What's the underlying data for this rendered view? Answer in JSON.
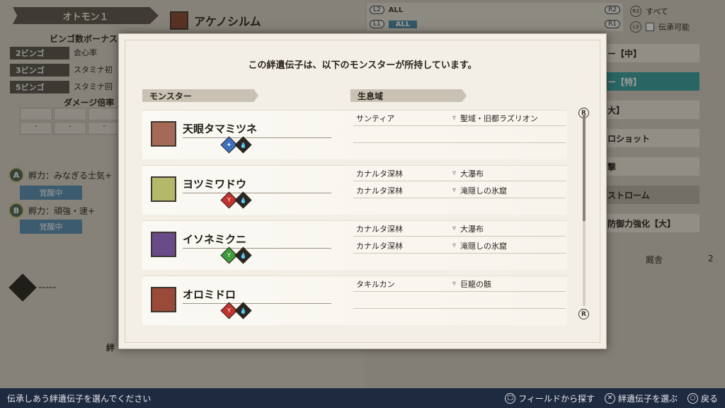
{
  "background": {
    "otomon_tab": "オトモン１",
    "monster_name": "アケノシルム",
    "bingo_title": "ビンゴ数ボーナス",
    "bingo_rows": [
      {
        "tag": "2ビンゴ",
        "effect": "会心率"
      },
      {
        "tag": "3ビンゴ",
        "effect": "スタミナ初"
      },
      {
        "tag": "5ビンゴ",
        "effect": "スタミナ回"
      }
    ],
    "damage_title": "ダメージ倍率",
    "damage_cells": [
      "-",
      "-",
      "-"
    ],
    "skill_a_badge": "A",
    "skill_a": "孵力：みなぎる士気+",
    "skill_b_badge": "B",
    "skill_b": "孵力：頑強・速+",
    "awake_label": "覚醒中",
    "dash_text": "-----",
    "left_bottom_text": "絆",
    "filter_l2": "L2",
    "filter_r2": "R2",
    "filter_l1": "L1",
    "filter_r1": "R1",
    "filter_all_top": "ALL",
    "filter_all_bottom": "ALL",
    "r3_btn": "R3",
    "l3_btn": "L3",
    "filter_right_top": "すべて",
    "filter_right_bottom": "伝承可能",
    "side_items": [
      {
        "label": "ー【中】",
        "style": "normal"
      },
      {
        "label": "ー【特】",
        "style": "special"
      },
      {
        "label": "大】",
        "style": "normal"
      },
      {
        "label": "ロショット",
        "style": "normal"
      },
      {
        "label": "撃",
        "style": "normal"
      },
      {
        "label": "ストローム",
        "style": "dark"
      },
      {
        "label": "防御力強化【大】",
        "style": "normal"
      }
    ],
    "kennel_label": "厩舎",
    "kennel_value": "2"
  },
  "modal": {
    "title": "この絆遺伝子は、以下のモンスターが所持しています。",
    "col_monster": "モンスター",
    "col_habitat": "生息域",
    "scroll_top_btn": "R",
    "scroll_bottom_btn": "R",
    "monsters": [
      {
        "name": "天眼タマミツネ",
        "icon": "tamamitsune-icon",
        "genes": [
          {
            "color": "blue",
            "glyph": "✦"
          },
          {
            "color": "black",
            "glyph": "💧"
          }
        ],
        "habitats": [
          {
            "region": "サンティア",
            "area": "聖域・旧都ラズリオン"
          },
          {
            "region": "",
            "area": ""
          }
        ]
      },
      {
        "name": "ヨツミワドウ",
        "icon": "yotsumiwadou-icon",
        "genes": [
          {
            "color": "red",
            "glyph": "Y"
          },
          {
            "color": "black",
            "glyph": "💧"
          }
        ],
        "habitats": [
          {
            "region": "カナルタ深林",
            "area": "大瀑布"
          },
          {
            "region": "カナルタ深林",
            "area": "滝隠しの氷窟"
          }
        ]
      },
      {
        "name": "イソネミクニ",
        "icon": "isonemikuni-icon",
        "genes": [
          {
            "color": "green",
            "glyph": "Y"
          },
          {
            "color": "black",
            "glyph": "💧"
          }
        ],
        "habitats": [
          {
            "region": "カナルタ深林",
            "area": "大瀑布"
          },
          {
            "region": "カナルタ深林",
            "area": "滝隠しの氷窟"
          }
        ]
      },
      {
        "name": "オロミドロ",
        "icon": "oromidoro-icon",
        "genes": [
          {
            "color": "red",
            "glyph": "Y"
          },
          {
            "color": "black",
            "glyph": "💧"
          }
        ],
        "habitats": [
          {
            "region": "タキルカン",
            "area": "巨龍の骸"
          },
          {
            "region": "",
            "area": ""
          }
        ]
      }
    ]
  },
  "bottom_bar": {
    "message": "伝承しあう絆遺伝子を選んでください",
    "hint_field_glyph": "□",
    "hint_field": "フィールドから探す",
    "hint_select_glyph": "✕",
    "hint_select": "絆遺伝子を選ぶ",
    "hint_back_glyph": "○",
    "hint_back": "戻る"
  }
}
